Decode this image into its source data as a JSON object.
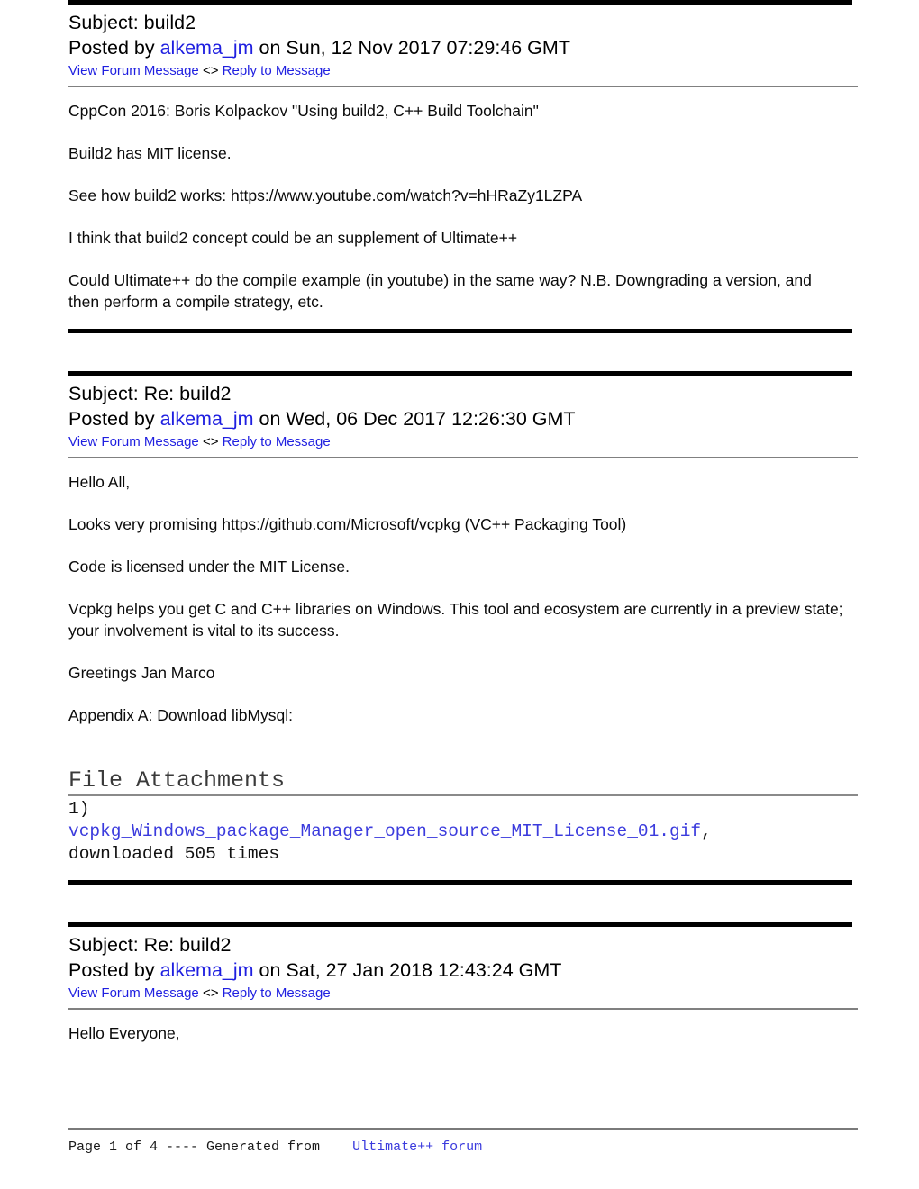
{
  "document": {
    "type": "forum-thread-printout",
    "link_color": "#1f1fe0",
    "mono_link_color": "#3b3bdd",
    "rule_color": "#808080"
  },
  "common": {
    "view_forum_message": "View Forum Message",
    "separator": "<>",
    "reply_to_message": "Reply to Message",
    "subject_prefix": "Subject: ",
    "posted_by_prefix": "Posted by ",
    "on_word": " on "
  },
  "posts": [
    {
      "subject": "build2",
      "author": "alkema_jm",
      "date": "Sun, 12 Nov 2017 07:29:46 GMT",
      "paragraphs": [
        "CppCon 2016: Boris Kolpackov \"Using build2, C++ Build Toolchain\"",
        "Build2 has MIT license.",
        "See how build2 works: https://www.youtube.com/watch?v=hHRaZy1LZPA",
        "I think that build2 concept could be an supplement of Ultimate++",
        "Could Ultimate++ do the compile example (in youtube) in the same way? N.B. Downgrading a version, and then perform a compile strategy, etc."
      ]
    },
    {
      "subject": "Re: build2",
      "author": "alkema_jm",
      "date": "Wed, 06 Dec 2017 12:26:30 GMT",
      "paragraphs": [
        "Hello All,",
        "Looks very promising https://github.com/Microsoft/vcpkg (VC++ Packaging Tool)",
        "Code is licensed under the MIT License.",
        "Vcpkg helps you get C and C++ libraries on Windows. This tool and ecosystem are currently in a preview state; your involvement is vital to its success.",
        "Greetings Jan Marco",
        "Appendix A: Download libMysql:"
      ],
      "attachments": {
        "title": "File Attachments",
        "index_label": "1)",
        "filename": "vcpkg_Windows_package_Manager_open_source_MIT_License_01.gif",
        "after_filename": ",",
        "download_text": "downloaded 505 times",
        "download_count": 505
      }
    },
    {
      "subject": "Re: build2",
      "author": "alkema_jm",
      "date": "Sat, 27 Jan 2018 12:43:24 GMT",
      "paragraphs": [
        "Hello Everyone,"
      ]
    }
  ],
  "footer": {
    "page_info": "Page 1 of 4 ---- Generated from",
    "spacer": "    ",
    "site_link": "Ultimate++ forum"
  }
}
